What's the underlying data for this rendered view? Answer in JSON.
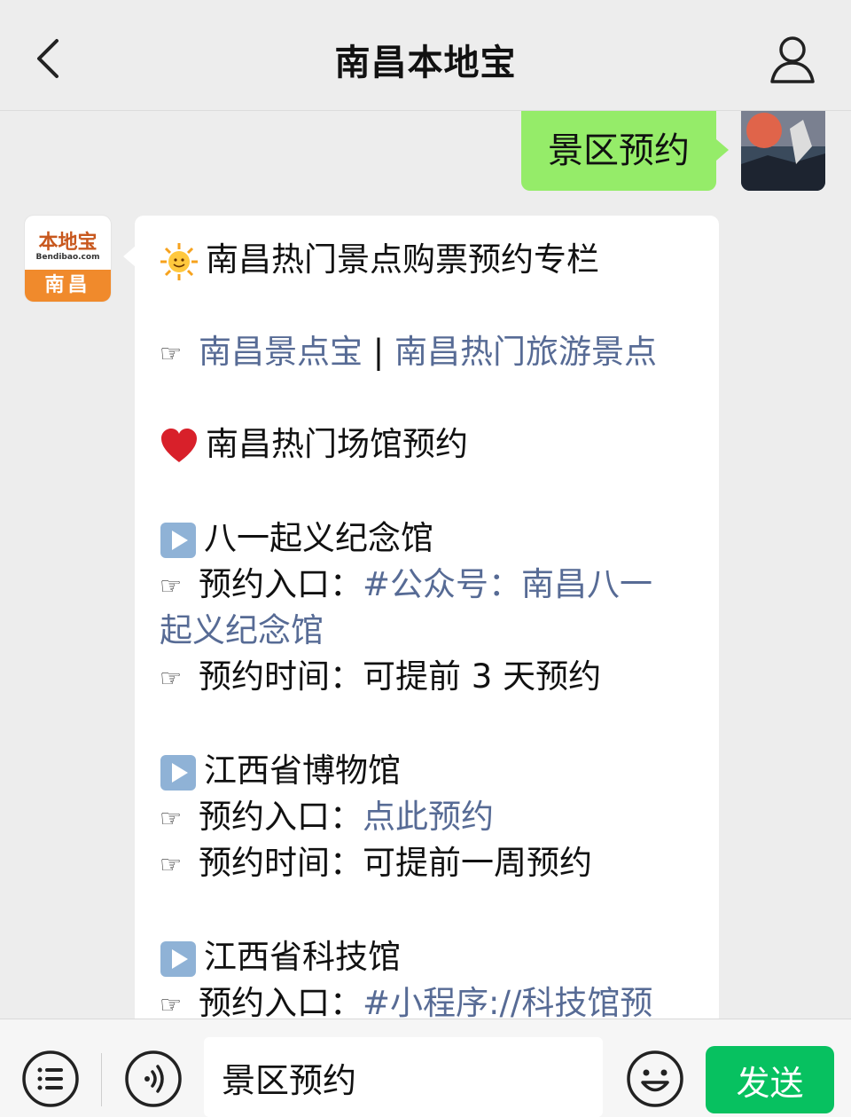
{
  "header": {
    "title": "南昌本地宝"
  },
  "sent_message": {
    "text": "景区预约"
  },
  "bot_avatar": {
    "logo_text": "本地宝",
    "logo_domain": "Bendibao.com",
    "city": "南昌"
  },
  "reply": {
    "headline": "南昌热门景点购票预约专栏",
    "links": {
      "attractions": "南昌景点宝",
      "separator": " | ",
      "hot_spots": "南昌热门旅游景点"
    },
    "venues_heading": "南昌热门场馆预约",
    "venues": [
      {
        "name": "八一起义纪念馆",
        "entry_label": "预约入口：",
        "entry_value_line1": "#公众号：南昌八一",
        "entry_value_line2": "起义纪念馆",
        "time_label": "预约时间：",
        "time_value": "可提前 3 天预约"
      },
      {
        "name": "江西省博物馆",
        "entry_label": "预约入口：",
        "entry_value": "点此预约",
        "time_label": "预约时间：",
        "time_value": "可提前一周预约"
      },
      {
        "name": "江西省科技馆",
        "entry_label": "预约入口：",
        "entry_value": "#小程序://科技馆预"
      }
    ]
  },
  "input_bar": {
    "value": "景区预约",
    "send_label": "发送"
  },
  "colors": {
    "sent_bubble": "#95ec69",
    "link": "#576b95",
    "send_button": "#07c160"
  }
}
